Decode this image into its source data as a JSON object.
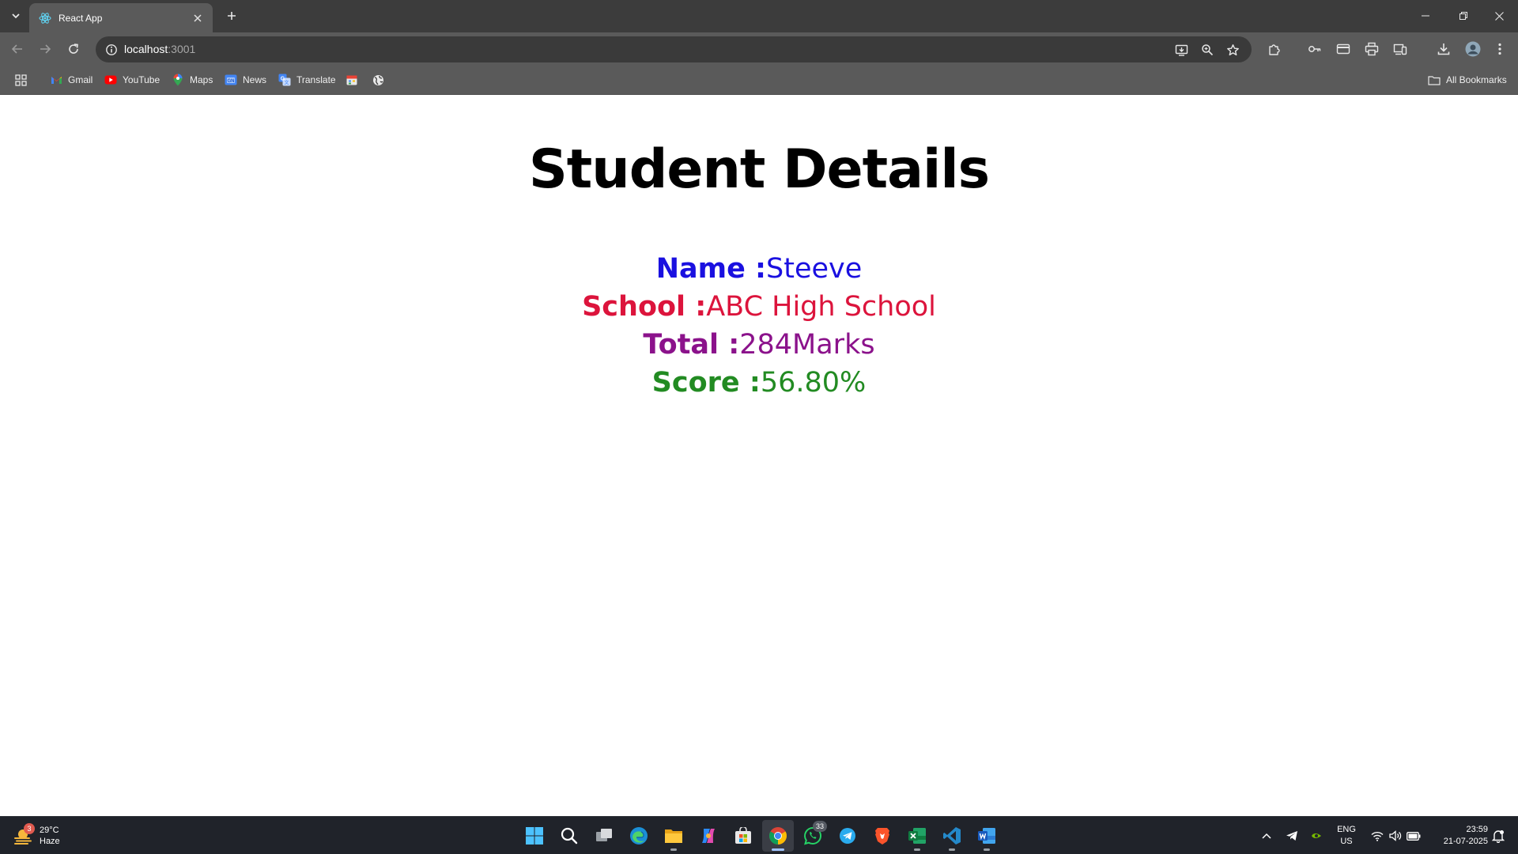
{
  "browser": {
    "tab_title": "React App",
    "url_host": "localhost",
    "url_port": ":3001"
  },
  "bookmarks": [
    {
      "label": "Gmail",
      "icon": "gmail-icon"
    },
    {
      "label": "YouTube",
      "icon": "youtube-icon"
    },
    {
      "label": "Maps",
      "icon": "maps-icon"
    },
    {
      "label": "News",
      "icon": "news-icon"
    },
    {
      "label": "Translate",
      "icon": "translate-icon"
    }
  ],
  "all_bookmarks_label": "All Bookmarks",
  "page": {
    "heading": "Student Details",
    "details": [
      {
        "label": "Name :",
        "value": "Steeve",
        "color": "#1a10e0"
      },
      {
        "label": "School :",
        "value": "ABC High School",
        "color": "#dc143c"
      },
      {
        "label": "Total :",
        "value": "284Marks",
        "color": "#8b128b"
      },
      {
        "label": "Score :",
        "value": "56.80%",
        "color": "#228b22"
      }
    ]
  },
  "taskbar": {
    "weather_temp": "29°C",
    "weather_desc": "Haze",
    "weather_badge": "3",
    "whatsapp_badge": "33",
    "language": "ENG",
    "region": "US",
    "time": "23:59",
    "date": "21-07-2025"
  },
  "colors": {
    "browser_frame": "#3c3c3c",
    "toolbar": "#5a5a5a",
    "taskbar": "#20232a"
  }
}
